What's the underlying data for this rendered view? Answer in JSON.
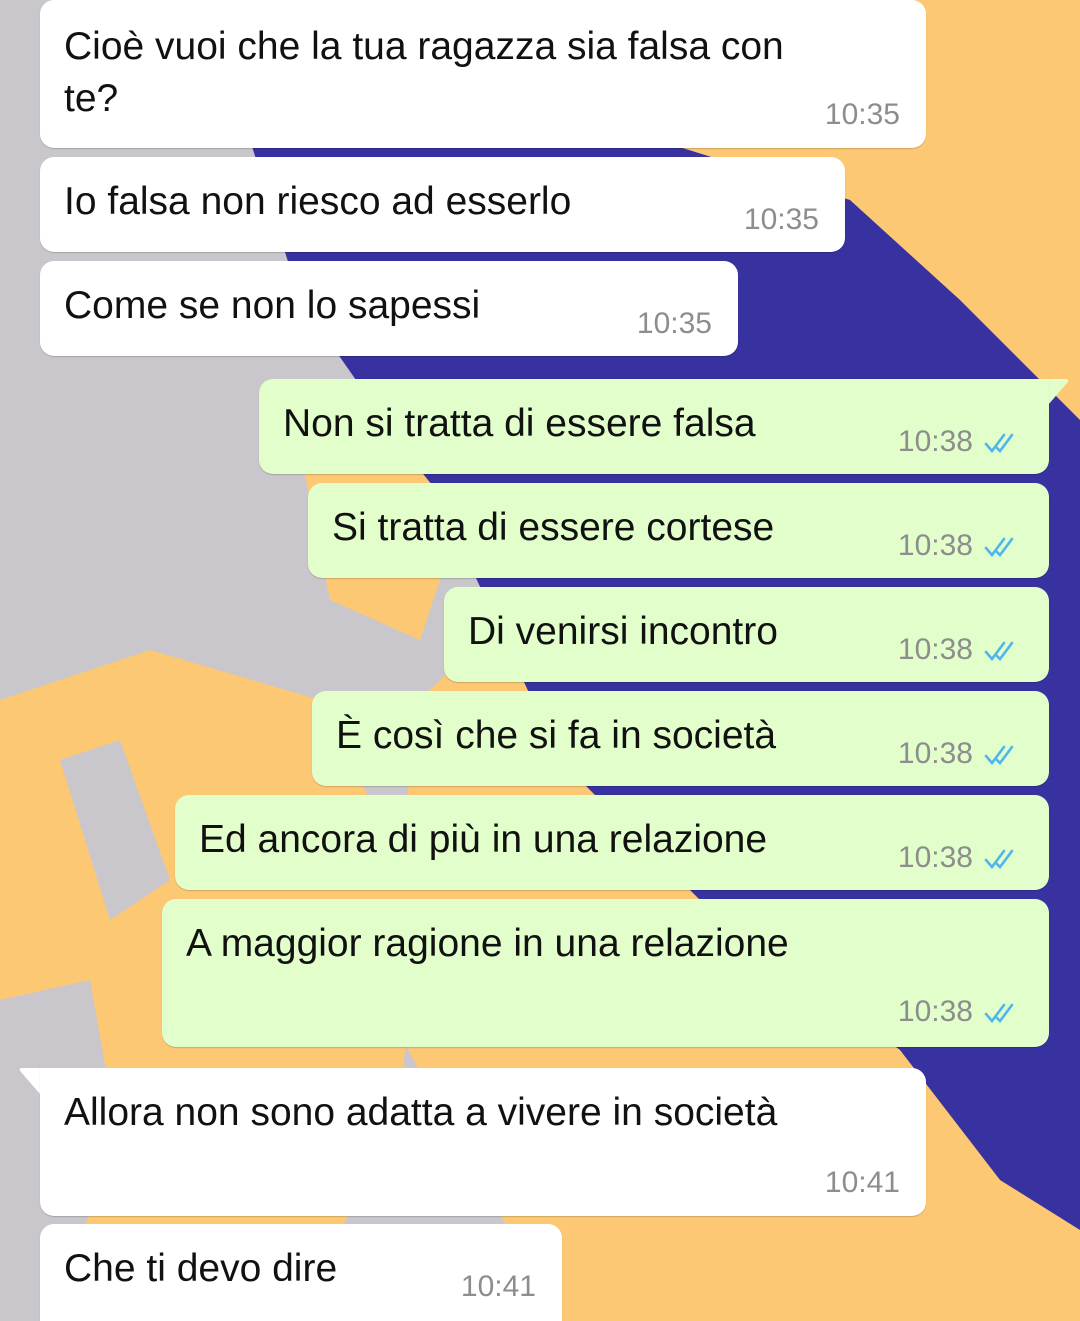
{
  "colors": {
    "incoming_bubble": "#ffffff",
    "outgoing_bubble": "#e1fecb",
    "read_ticks": "#4fb6ec",
    "wallpaper_orange": "#fdc874",
    "wallpaper_blue": "#3732a0",
    "wallpaper_gray": "#c9c6cc"
  },
  "messages": [
    {
      "direction": "in",
      "text_lines": [
        "Cioè vuoi che la tua ragazza sia falsa con",
        "te?"
      ],
      "time": "10:35"
    },
    {
      "direction": "in",
      "text_lines": [
        "Io falsa non riesco ad esserlo"
      ],
      "time": "10:35"
    },
    {
      "direction": "in",
      "text_lines": [
        "Come se non lo sapessi"
      ],
      "time": "10:35"
    },
    {
      "direction": "out",
      "text_lines": [
        "Non si tratta di essere falsa"
      ],
      "time": "10:38",
      "status": "read"
    },
    {
      "direction": "out",
      "text_lines": [
        "Si tratta di essere cortese"
      ],
      "time": "10:38",
      "status": "read"
    },
    {
      "direction": "out",
      "text_lines": [
        "Di venirsi incontro"
      ],
      "time": "10:38",
      "status": "read"
    },
    {
      "direction": "out",
      "text_lines": [
        "È così che si fa in società"
      ],
      "time": "10:38",
      "status": "read"
    },
    {
      "direction": "out",
      "text_lines": [
        "Ed ancora di più in una relazione"
      ],
      "time": "10:38",
      "status": "read"
    },
    {
      "direction": "out",
      "text_lines": [
        "A maggior ragione in una relazione"
      ],
      "time": "10:38",
      "status": "read"
    },
    {
      "direction": "in",
      "text_lines": [
        "Allora non sono adatta a vivere in società"
      ],
      "time": "10:41"
    },
    {
      "direction": "in",
      "text_lines": [
        "Che ti devo dire"
      ],
      "time": "10:41"
    }
  ]
}
